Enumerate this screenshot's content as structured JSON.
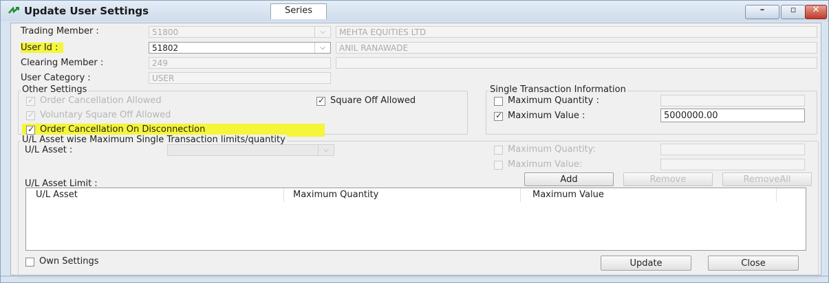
{
  "window": {
    "title": "Update User Settings",
    "tab": "Series",
    "min": "–",
    "max": "▫",
    "close": "✕"
  },
  "form": {
    "trading_member_label": "Trading Member :",
    "trading_member_value": "51800",
    "trading_member_name": "MEHTA EQUITIES LTD",
    "user_id_label": "User Id :",
    "user_id_value": "51802",
    "user_name": "ANIL RANAWADE",
    "clearing_member_label": "Clearing Member :",
    "clearing_member_value": "249",
    "user_category_label": "User Category :",
    "user_category_value": "USER"
  },
  "other_settings": {
    "title": "Other Settings",
    "order_cancellation_allowed": "Order Cancellation Allowed",
    "voluntary_square_off": "Voluntary Square Off Allowed",
    "square_off_allowed": "Square Off Allowed",
    "order_cancel_on_disconnect": "Order Cancellation On Disconnection"
  },
  "single_txn": {
    "title": "Single Transaction Information",
    "max_qty_label": "Maximum Quantity :",
    "max_value_label": "Maximum Value :",
    "max_value": "5000000.00"
  },
  "ul_section": {
    "title": "U/L Asset wise Maximum Single Transaction limits/quantity",
    "asset_label": "U/L Asset :",
    "max_qty_label": "Maximum Quantity:",
    "max_value_label": "Maximum Value:",
    "add": "Add",
    "remove": "Remove",
    "remove_all": "RemoveAll",
    "limit_label": "U/L Asset Limit :",
    "columns": [
      "U/L Asset",
      "Maximum Quantity",
      "Maximum Value"
    ]
  },
  "footer": {
    "own_settings": "Own Settings",
    "update": "Update",
    "close": "Close"
  },
  "colors": {
    "highlight": "#f5f53a",
    "title_bg": "#d9e4f1"
  }
}
